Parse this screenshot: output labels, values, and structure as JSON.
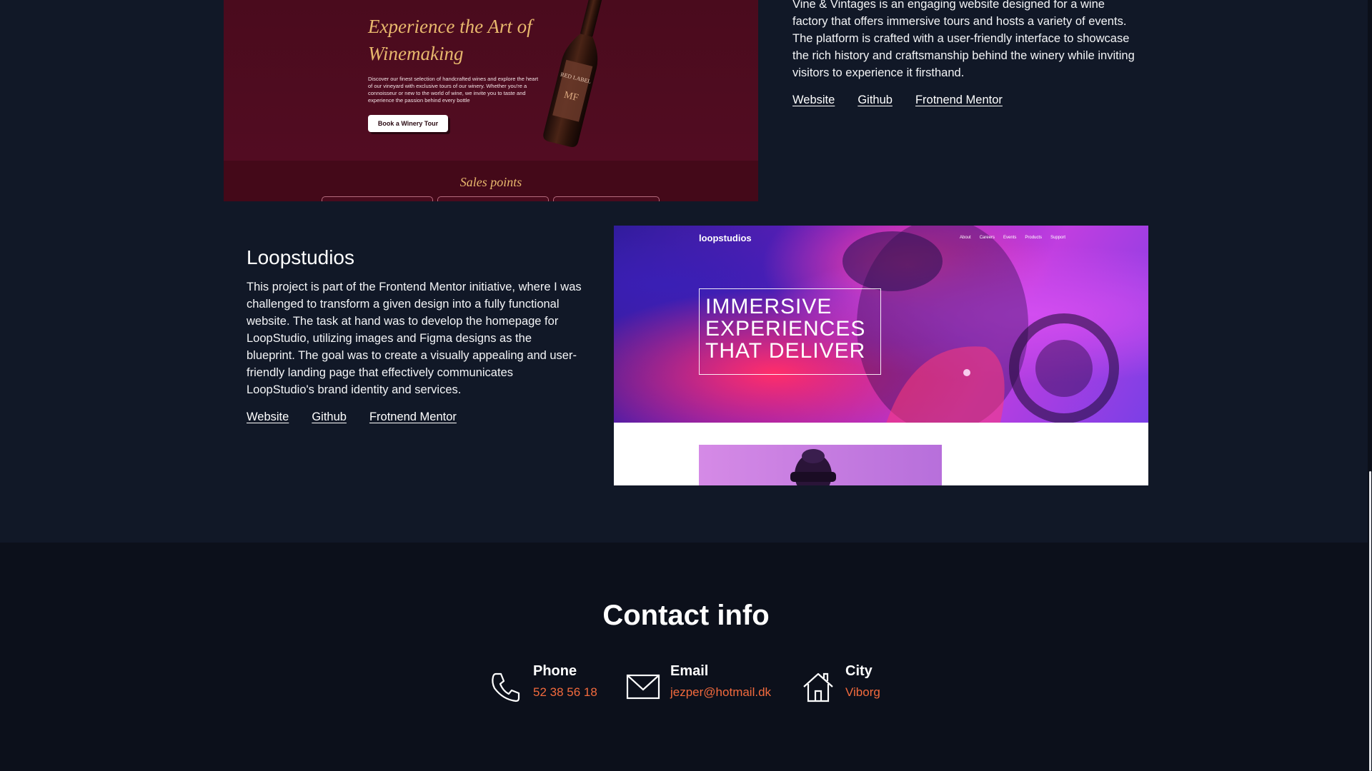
{
  "vine": {
    "preview": {
      "heading_line1": "Experience the Art of",
      "heading_line2": "Winemaking",
      "body": "Discover our finest selection of handcrafted wines and explore the heart of our vineyard with exclusive tours of our winery. Whether you're a connoisseur or new to the world of wine, we invite you to taste and experience the passion behind every bottle",
      "button": "Book a Winery Tour",
      "bottle_label": "RED LABEL",
      "bottle_mark": "MF",
      "sales_title": "Sales points"
    },
    "description": "Vine & Vintages is an engaging website designed for a wine factory that offers immersive tours and hosts a variety of events. The platform is crafted with a user-friendly interface to showcase the rich history and craftsmanship behind the winery while inviting visitors to experience it firsthand.",
    "links": {
      "website": "Website",
      "github": "Github",
      "mentor": "Frotnend Mentor"
    }
  },
  "loop": {
    "title": "Loopstudios",
    "description": "This project is part of the Frontend Mentor initiative, where I was challenged to transform a given design into a fully functional website. The task at hand was to develop the homepage for LoopStudio, utilizing images and Figma designs as the blueprint. The goal was to create a visually appealing and user-friendly landing page that effectively communicates LoopStudio's brand identity and services.",
    "links": {
      "website": "Website",
      "github": "Github",
      "mentor": "Frotnend Mentor"
    },
    "preview": {
      "logo": "loopstudios",
      "nav": [
        "About",
        "Careers",
        "Events",
        "Products",
        "Support"
      ],
      "hero_line1": "IMMERSIVE",
      "hero_line2": "EXPERIENCES",
      "hero_line3": "THAT DELIVER"
    }
  },
  "contact": {
    "title": "Contact info",
    "phone": {
      "label": "Phone",
      "value": "52 38 56 18",
      "icon": "phone-icon"
    },
    "email": {
      "label": "Email",
      "value": "jezper@hotmail.dk",
      "icon": "envelope-icon"
    },
    "city": {
      "label": "City",
      "value": "Viborg",
      "icon": "home-icon"
    }
  },
  "colors": {
    "background": "#111827",
    "footer": "#0c101b",
    "accent": "#f26a3d",
    "wine": "#4c0a1f",
    "gold": "#e8b86d"
  }
}
